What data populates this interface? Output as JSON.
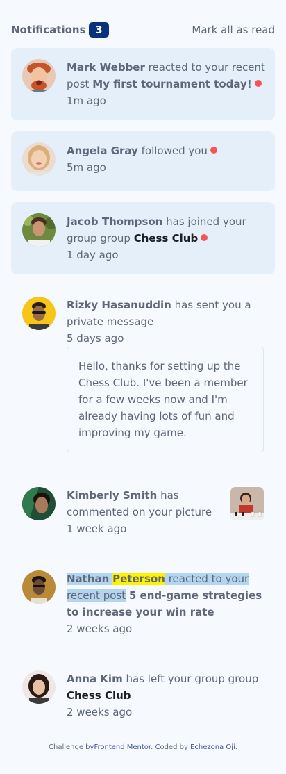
{
  "header": {
    "title": "Notifications",
    "count": "3",
    "mark_all": "Mark all as read"
  },
  "notifications": [
    {
      "user": "Mark Webber",
      "action": "reacted to your recent post",
      "object": "My first tournament today!",
      "time": "1m ago",
      "unread": true
    },
    {
      "user": "Angela Gray",
      "action": "followed you",
      "time": "5m ago",
      "unread": true
    },
    {
      "user": "Jacob Thompson",
      "action": "has joined your group group",
      "object": "Chess Club",
      "time": "1 day ago",
      "unread": true
    },
    {
      "user": "Rizky Hasanuddin",
      "action": "has sent you a private message",
      "time": "5 days ago",
      "message": "Hello, thanks for setting up the Chess Club. I've been a member for a few weeks now and I'm already having lots of fun and improving my game.",
      "unread": false
    },
    {
      "user": "Kimberly Smith",
      "action": "has commented on your picture",
      "time": "1 week ago",
      "unread": false
    },
    {
      "user_first": "Nathan",
      "user_last": "Peterson",
      "action": "reacted to your recent post",
      "object": "5 end-game strategies to increase your win rate",
      "time": "2 weeks ago",
      "unread": false
    },
    {
      "user": "Anna Kim",
      "action": "has left your group group",
      "object": "Chess Club",
      "time": "2 weeks ago",
      "unread": false
    }
  ],
  "footer": {
    "prefix": "Challenge by",
    "link1": "Frontend Mentor",
    "middle": ". Coded by ",
    "link2": "Echezona Oji",
    "suffix": "."
  },
  "colors": {
    "unread_bg": "#e5effa",
    "badge": "#0a317b",
    "dot": "#f65552",
    "text": "#5e6778",
    "page_bg": "#f6f9fd"
  }
}
